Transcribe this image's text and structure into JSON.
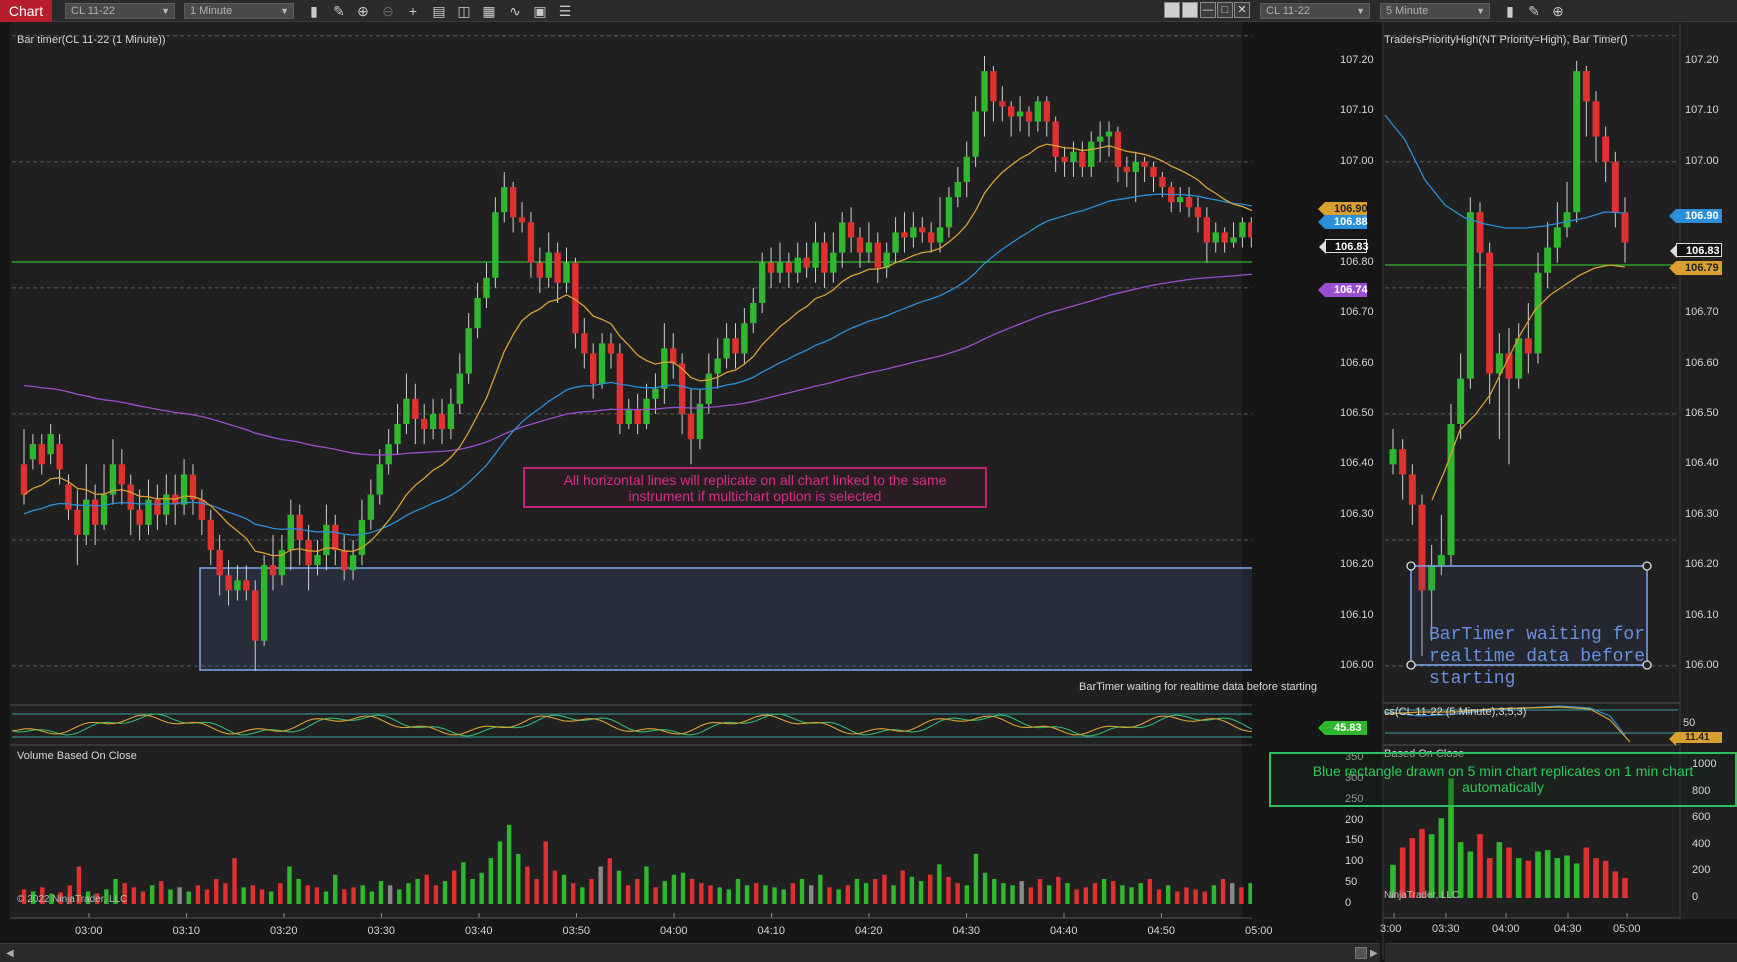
{
  "toolbar_left": {
    "chart_button": "Chart",
    "instrument": "CL 11-22",
    "interval": "1 Minute"
  },
  "toolbar_right": {
    "instrument": "CL 11-22",
    "interval": "5 Minute"
  },
  "icons": [
    "bar-type-icon",
    "pencil-icon",
    "zoom-in-icon",
    "zoom-out-icon",
    "crosshair-icon",
    "data-box-icon",
    "properties-icon",
    "indicators-icon",
    "strategy-icon",
    "templates-icon",
    "list-icon"
  ],
  "left_chart": {
    "indicator_label": "Bar timer(CL 11-22 (1 Minute))",
    "volume_label": "Volume Based On Close",
    "copyright": "© 2022 NinjaTrader, LLC",
    "bartimer_status": "BarTimer waiting for realtime data before starting",
    "annotation": "All horizontal lines will replicate on all chart linked to the same instrument if multichart option is selected",
    "price_ticks": [
      "107.20",
      "107.10",
      "107.00",
      "106.90",
      "106.80",
      "106.70",
      "106.60",
      "106.50",
      "106.40",
      "106.30",
      "106.20",
      "106.10",
      "106.00"
    ],
    "volume_ticks": [
      "350",
      "300",
      "250",
      "200",
      "150",
      "100",
      "50",
      "0"
    ],
    "time_ticks": [
      "03:00",
      "03:10",
      "03:20",
      "03:30",
      "03:40",
      "03:50",
      "04:00",
      "04:10",
      "04:20",
      "04:30",
      "04:40",
      "04:50",
      "05:00"
    ],
    "tags": {
      "orange": "106.90",
      "blue": "106.88",
      "last": "106.83",
      "purple": "106.74",
      "stoch": "45.83"
    }
  },
  "right_chart": {
    "indicator_label": "TradersPriorityHigh(NT Priority=High), Bar Timer()",
    "stoch_label": "cs(CL 11-22 (5 Minute),3,5,3)",
    "volume_label": "Based On Close",
    "copyright": "NinjaTrader, LLC",
    "bartimer_status": "BarTimer waiting for realtime data before starting",
    "annotation": "Blue rectangle drawn on 5 min chart replicates on 1 min chart automatically",
    "price_ticks": [
      "107.20",
      "107.10",
      "107.00",
      "106.70",
      "106.60",
      "106.50",
      "106.40",
      "106.30",
      "106.20",
      "106.10",
      "106.00"
    ],
    "volume_ticks": [
      "1000",
      "800",
      "600",
      "400",
      "200",
      "0"
    ],
    "stoch_tick": "50",
    "time_ticks": [
      "3:00",
      "03:30",
      "04:00",
      "04:30",
      "05:00"
    ],
    "tags": {
      "blue": "106.90",
      "last": "106.83",
      "orange": "106.79",
      "stoch": "11.41"
    }
  },
  "colors": {
    "up": "#2eb82e",
    "down": "#e03030",
    "ma_orange": "#d9a030",
    "ma_blue": "#2a8fd8",
    "ma_purple": "#9a4fd0",
    "accent": "#b81d2b"
  }
}
